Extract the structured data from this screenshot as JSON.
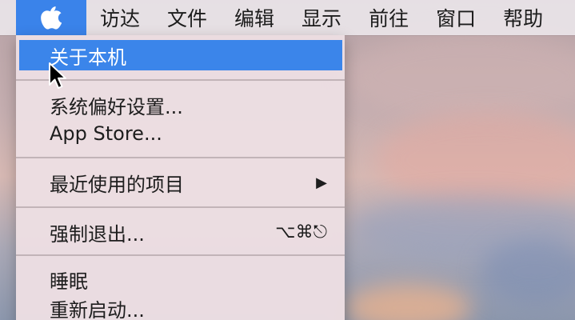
{
  "menubar": {
    "apple_icon": "apple-logo-icon",
    "items": [
      {
        "label": "访达"
      },
      {
        "label": "文件"
      },
      {
        "label": "编辑"
      },
      {
        "label": "显示"
      },
      {
        "label": "前往"
      },
      {
        "label": "窗口"
      },
      {
        "label": "帮助"
      }
    ]
  },
  "apple_menu": {
    "items": [
      {
        "label": "关于本机",
        "highlighted": true
      },
      {
        "label": "系统偏好设置..."
      },
      {
        "label": "App Store..."
      },
      {
        "label": "最近使用的项目",
        "submenu_arrow": "▶"
      },
      {
        "label": "强制退出...",
        "shortcut": "⌥⌘⎋"
      },
      {
        "label": "睡眠"
      },
      {
        "label": "重新启动..."
      }
    ]
  },
  "colors": {
    "highlight": "#3b85ea",
    "menubar_bg": "#e8e2e6",
    "menu_bg": "#ecdee2"
  }
}
